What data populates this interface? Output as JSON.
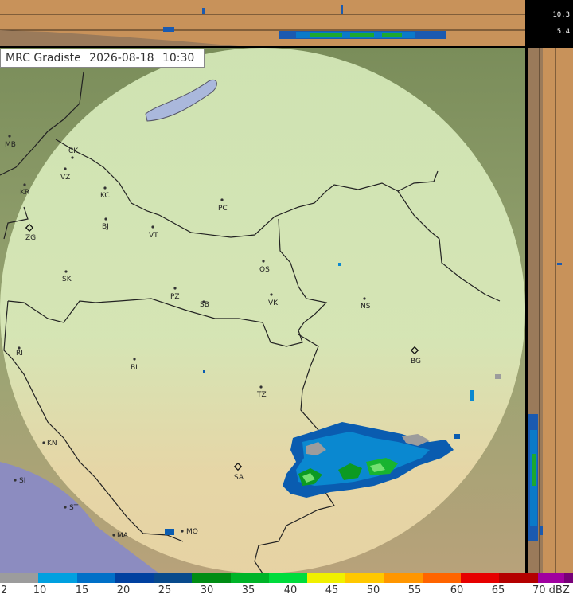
{
  "title": {
    "station": "MRC Gradiste",
    "date": "2026-08-18",
    "time": "10:30"
  },
  "height_labels": {
    "top": "10.3",
    "bottom": "5.4"
  },
  "cities": [
    {
      "code": "MB"
    },
    {
      "code": "CK"
    },
    {
      "code": "VZ"
    },
    {
      "code": "KR"
    },
    {
      "code": "KC"
    },
    {
      "code": "PC"
    },
    {
      "code": "ZG"
    },
    {
      "code": "BJ"
    },
    {
      "code": "VT"
    },
    {
      "code": "OS"
    },
    {
      "code": "SK"
    },
    {
      "code": "PZ"
    },
    {
      "code": "SB"
    },
    {
      "code": "VK"
    },
    {
      "code": "NS"
    },
    {
      "code": "RI"
    },
    {
      "code": "BL"
    },
    {
      "code": "BG"
    },
    {
      "code": "TZ"
    },
    {
      "code": "KN"
    },
    {
      "code": "SA"
    },
    {
      "code": "SI"
    },
    {
      "code": "ST"
    },
    {
      "code": "MO"
    },
    {
      "code": "MA"
    }
  ],
  "legend": {
    "unit": "dBZ",
    "labels": [
      "2",
      "10",
      "15",
      "20",
      "25",
      "30",
      "35",
      "40",
      "45",
      "50",
      "55",
      "60",
      "65",
      "70"
    ],
    "colors": [
      "#9c9c9c",
      "#00a0e0",
      "#0070c8",
      "#0040a0",
      "#084a8c",
      "#008c14",
      "#00b428",
      "#00dc3c",
      "#f0f000",
      "#ffc800",
      "#ff9600",
      "#ff6400",
      "#e60000",
      "#b40000",
      "#a000a0",
      "#780078"
    ]
  },
  "colors": {
    "panel": "#c8925a",
    "radar_disk": "#d8f0c0",
    "water": "#b8c4e8"
  }
}
